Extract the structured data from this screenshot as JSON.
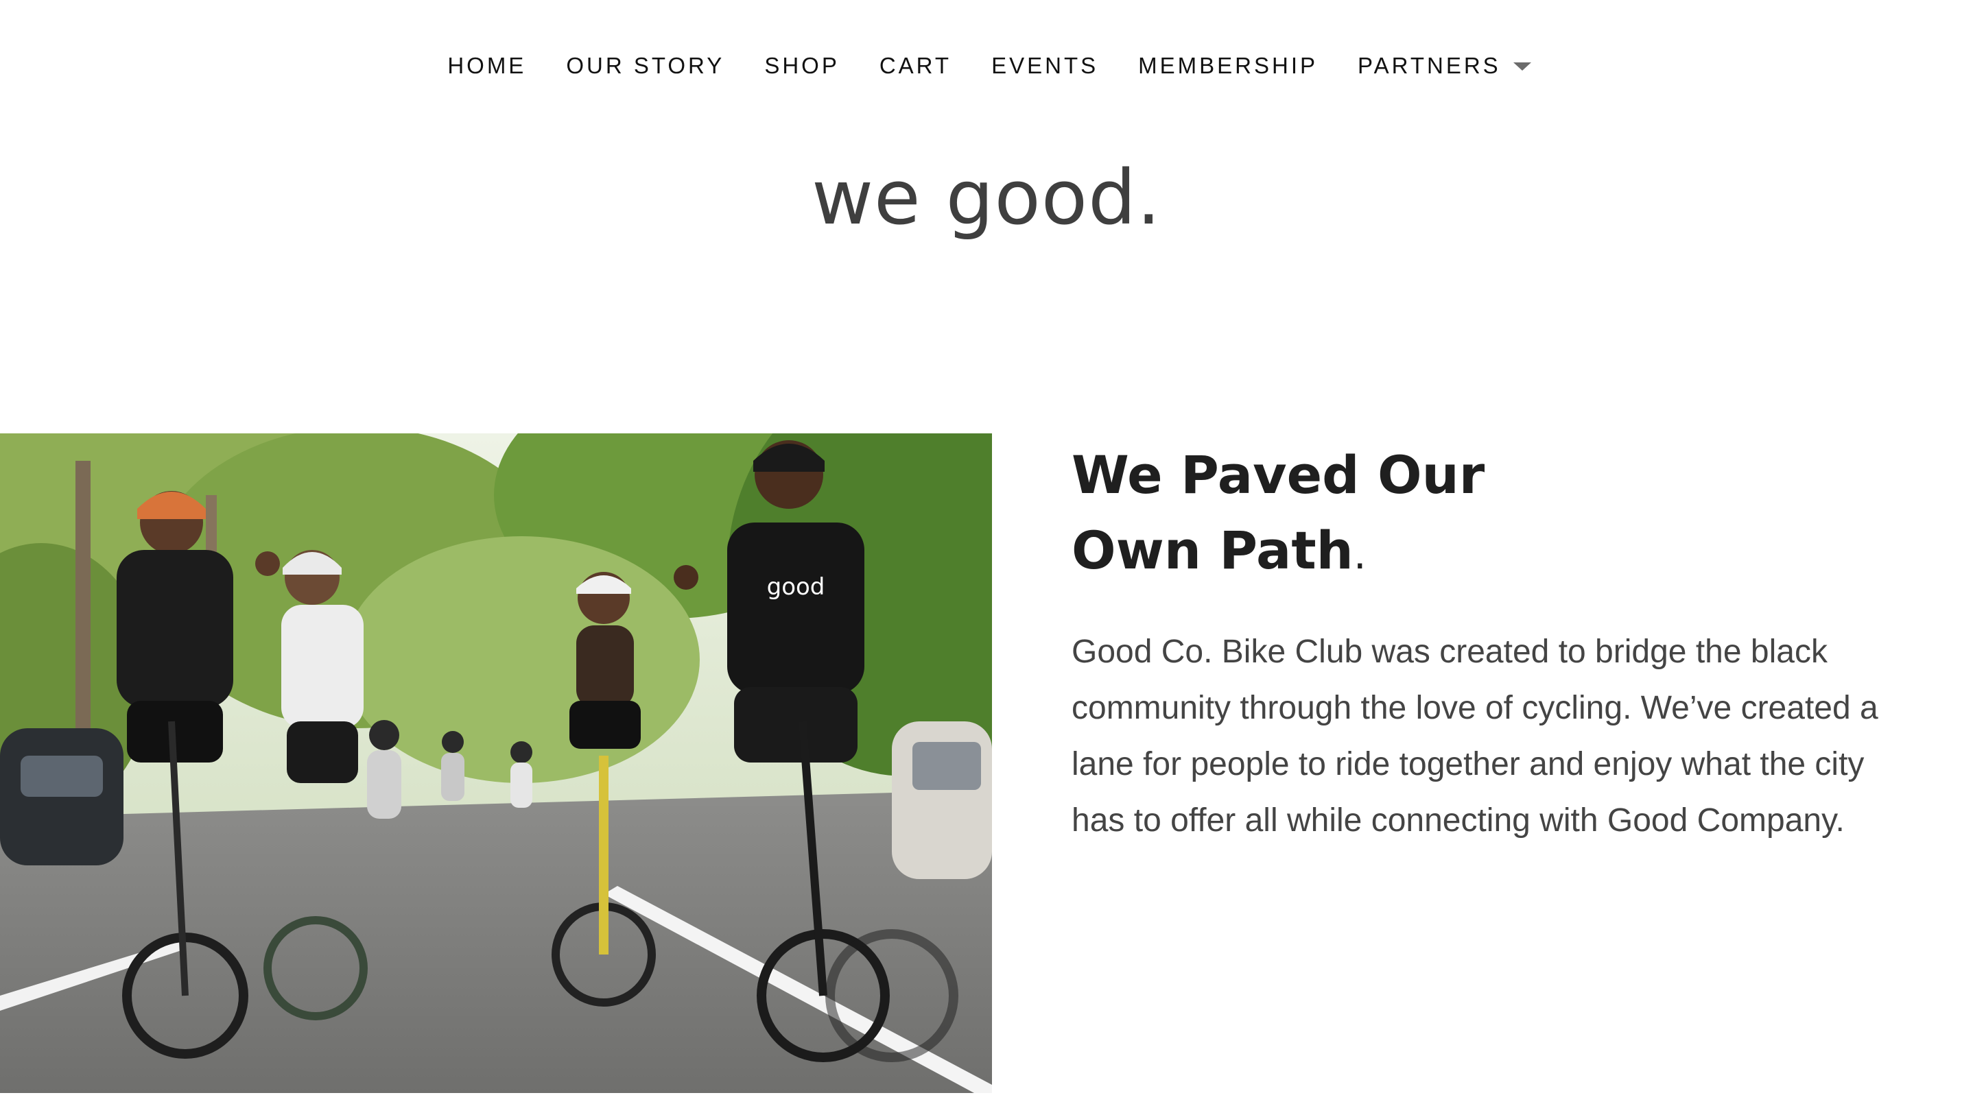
{
  "nav": {
    "items": [
      {
        "label": "HOME"
      },
      {
        "label": "OUR STORY"
      },
      {
        "label": "SHOP"
      },
      {
        "label": "CART"
      },
      {
        "label": "EVENTS"
      },
      {
        "label": "MEMBERSHIP"
      },
      {
        "label": "PARTNERS",
        "has_dropdown": true,
        "icon": "chevron-down-icon"
      }
    ]
  },
  "site": {
    "title": "we good."
  },
  "hero": {
    "photo_icon": "group-cycling-photo"
  },
  "about": {
    "headline_line1": "We Paved Our",
    "headline_line2": "Own Path",
    "headline_period": ".",
    "body": "Good Co. Bike Club was created to bridge the black community through the love of cycling. We’ve created a lane for people to ride together and enjoy what the city has to offer all while connecting with Good Company."
  },
  "colors": {
    "nav_text": "#111111",
    "title_text": "#3f3f3f",
    "headline_text": "#1f1f1f",
    "body_text": "#444444",
    "background": "#ffffff"
  }
}
